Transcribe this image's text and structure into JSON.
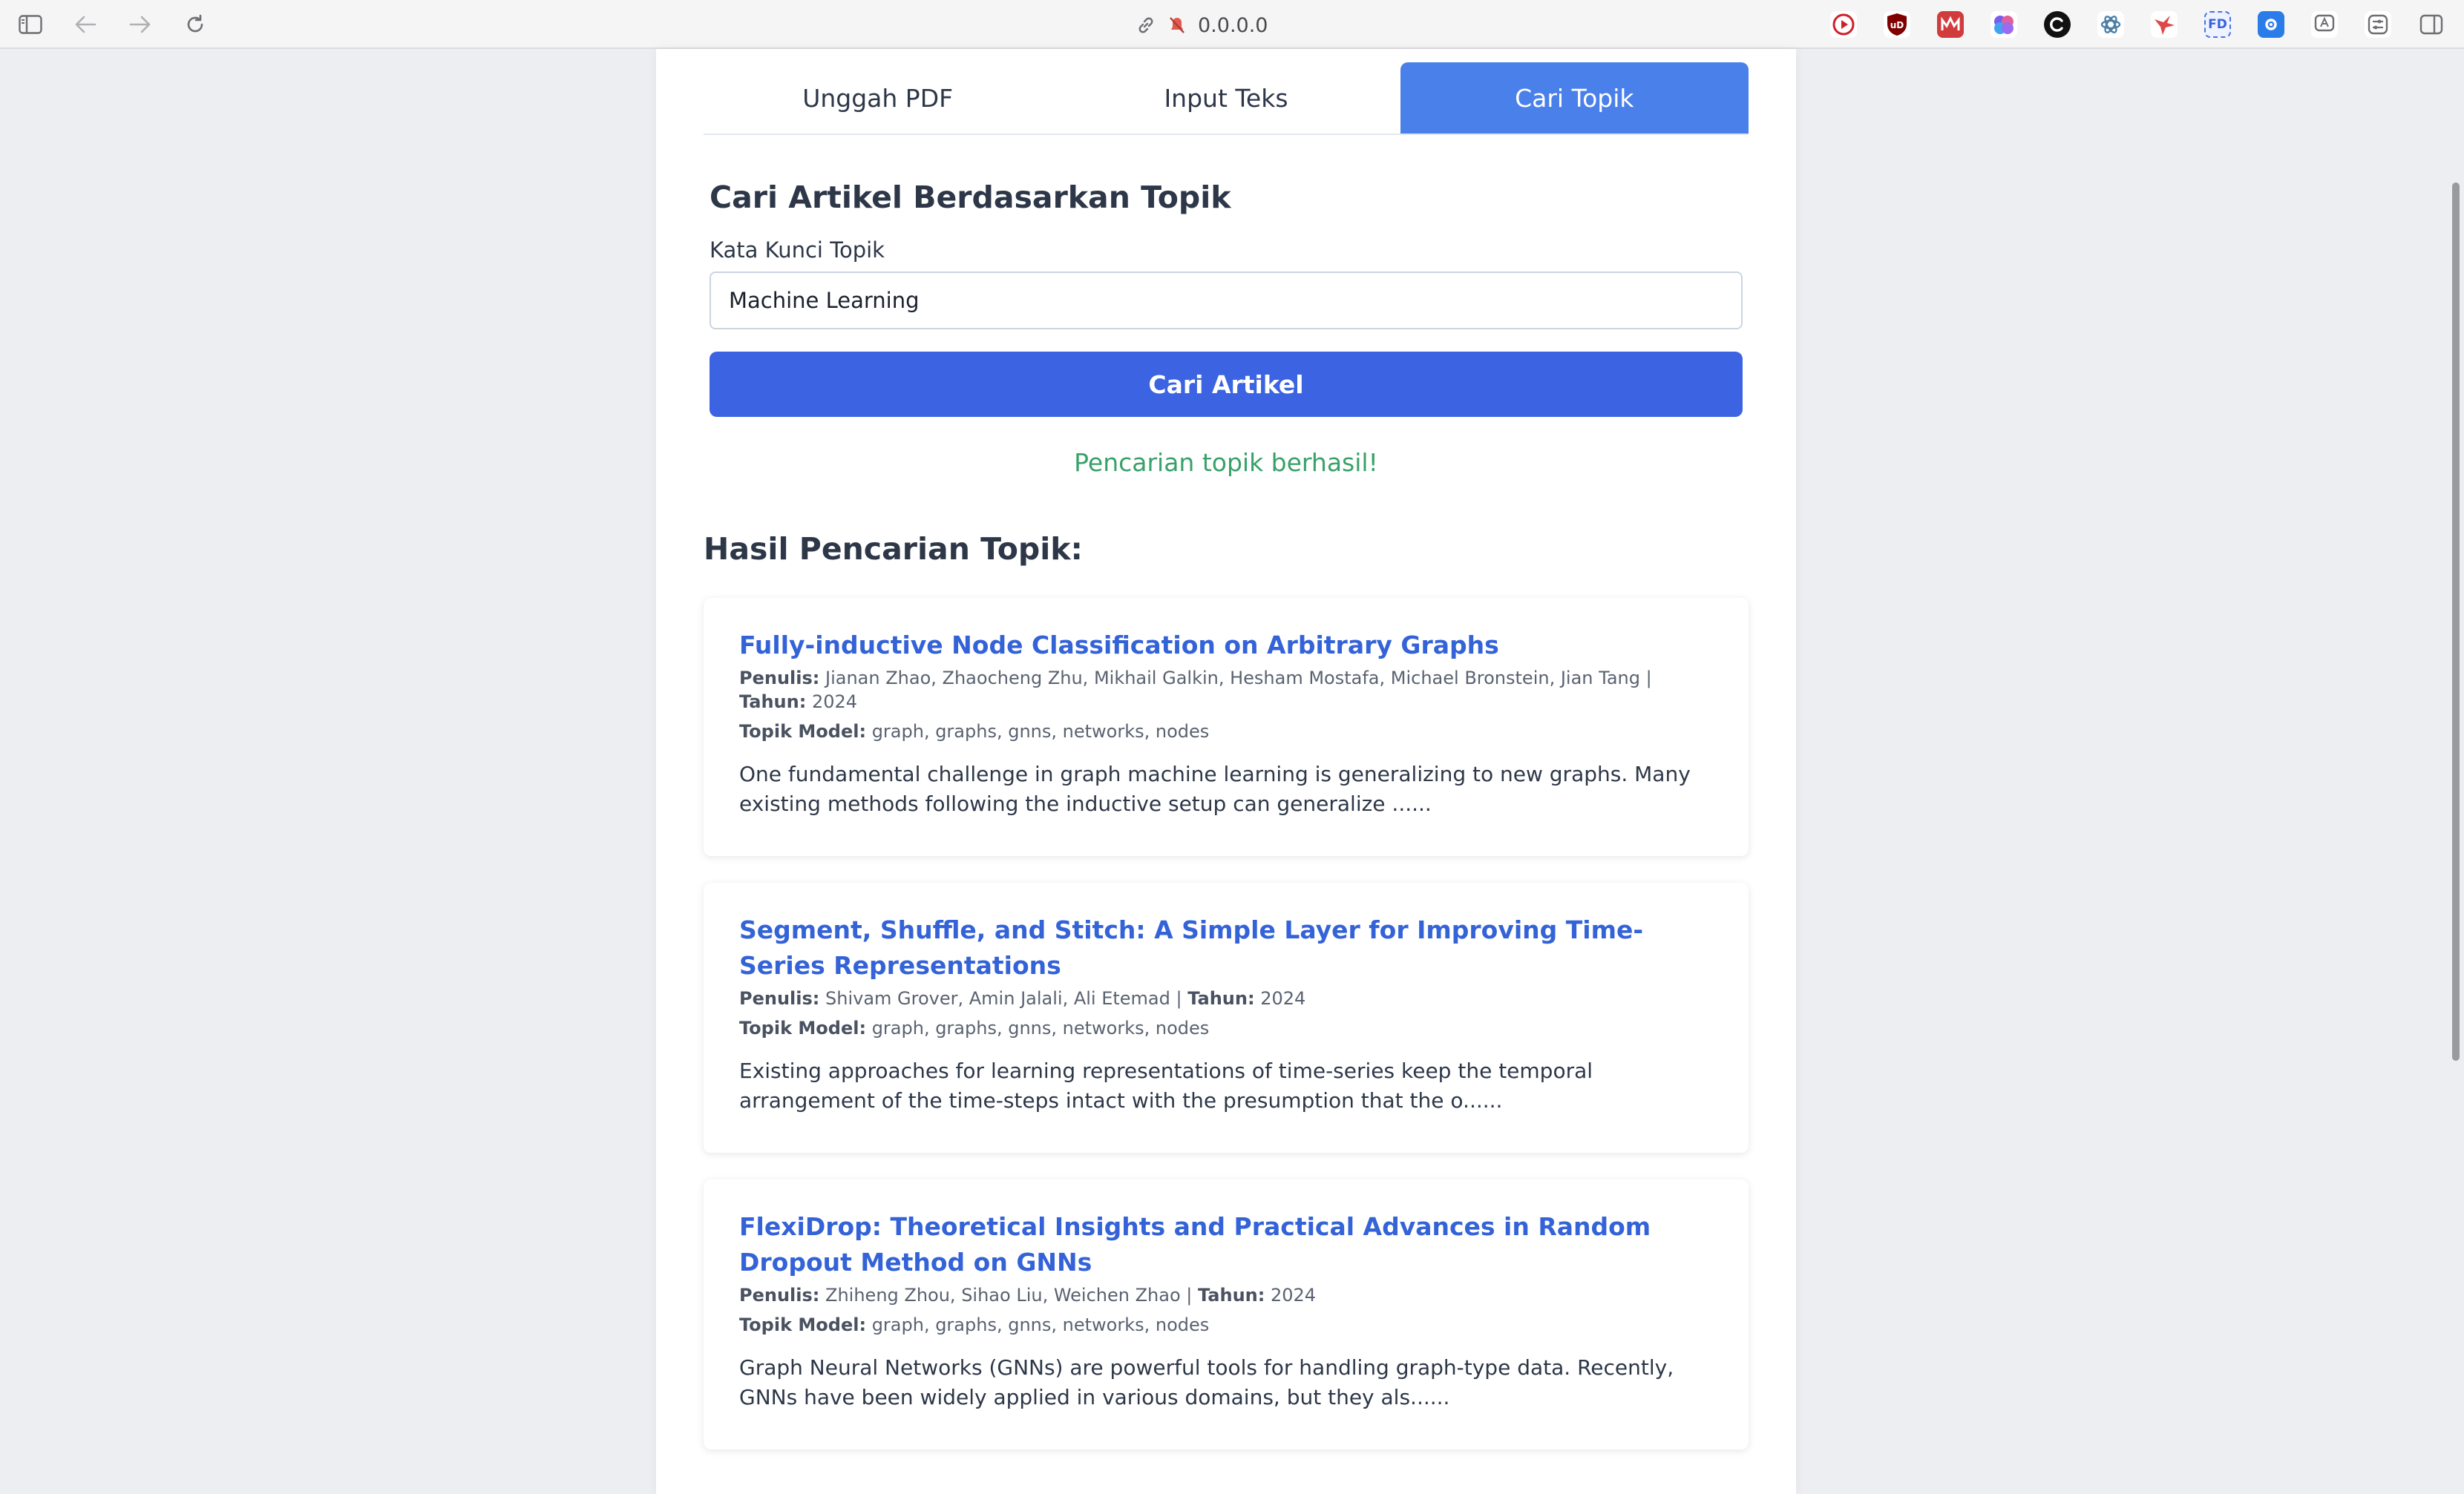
{
  "browser": {
    "url": "0.0.0.0",
    "icons": [
      "sidebar-toggle-icon",
      "back-arrow-icon",
      "forward-arrow-icon",
      "reload-icon"
    ],
    "extensions": [
      "youtube-ext-icon",
      "ublock-ext-icon",
      "monkey-ext-icon",
      "brain-ext-icon",
      "chatgpt-ext-icon",
      "openai-ext-icon",
      "bird-ext-icon",
      "fd-ext-icon",
      "gear-ext-icon",
      "translate-ext-icon",
      "sliders-ext-icon",
      "split-view-icon"
    ]
  },
  "tabs": [
    {
      "label": "Unggah PDF",
      "active": false
    },
    {
      "label": "Input Teks",
      "active": false
    },
    {
      "label": "Cari Topik",
      "active": true
    }
  ],
  "search": {
    "heading": "Cari Artikel Berdasarkan Topik",
    "label": "Kata Kunci Topik",
    "value": "Machine Learning",
    "button": "Cari Artikel",
    "status": "Pencarian topik berhasil!"
  },
  "results": {
    "heading": "Hasil Pencarian Topik:",
    "author_label": "Penulis:",
    "year_label": "Tahun:",
    "topic_label": "Topik Model:",
    "items": [
      {
        "title": "Fully-inductive Node Classification on Arbitrary Graphs",
        "authors": "Jianan Zhao, Zhaocheng Zhu, Mikhail Galkin, Hesham Mostafa, Michael Bronstein, Jian Tang",
        "year": "2024",
        "topics": "graph, graphs, gnns, networks, nodes",
        "abstract": "One fundamental challenge in graph machine learning is generalizing to new graphs. Many existing methods following the inductive setup can generalize ......"
      },
      {
        "title": "Segment, Shuffle, and Stitch: A Simple Layer for Improving Time-Series Representations",
        "authors": "Shivam Grover, Amin Jalali, Ali Etemad",
        "year": "2024",
        "topics": "graph, graphs, gnns, networks, nodes",
        "abstract": "Existing approaches for learning representations of time-series keep the temporal arrangement of the time-steps intact with the presumption that the o......"
      },
      {
        "title": "FlexiDrop: Theoretical Insights and Practical Advances in Random Dropout Method on GNNs",
        "authors": "Zhiheng Zhou, Sihao Liu, Weichen Zhao",
        "year": "2024",
        "topics": "graph, graphs, gnns, networks, nodes",
        "abstract": "Graph Neural Networks (GNNs) are powerful tools for handling graph-type data. Recently, GNNs have been widely applied in various domains, but they als......"
      }
    ]
  }
}
